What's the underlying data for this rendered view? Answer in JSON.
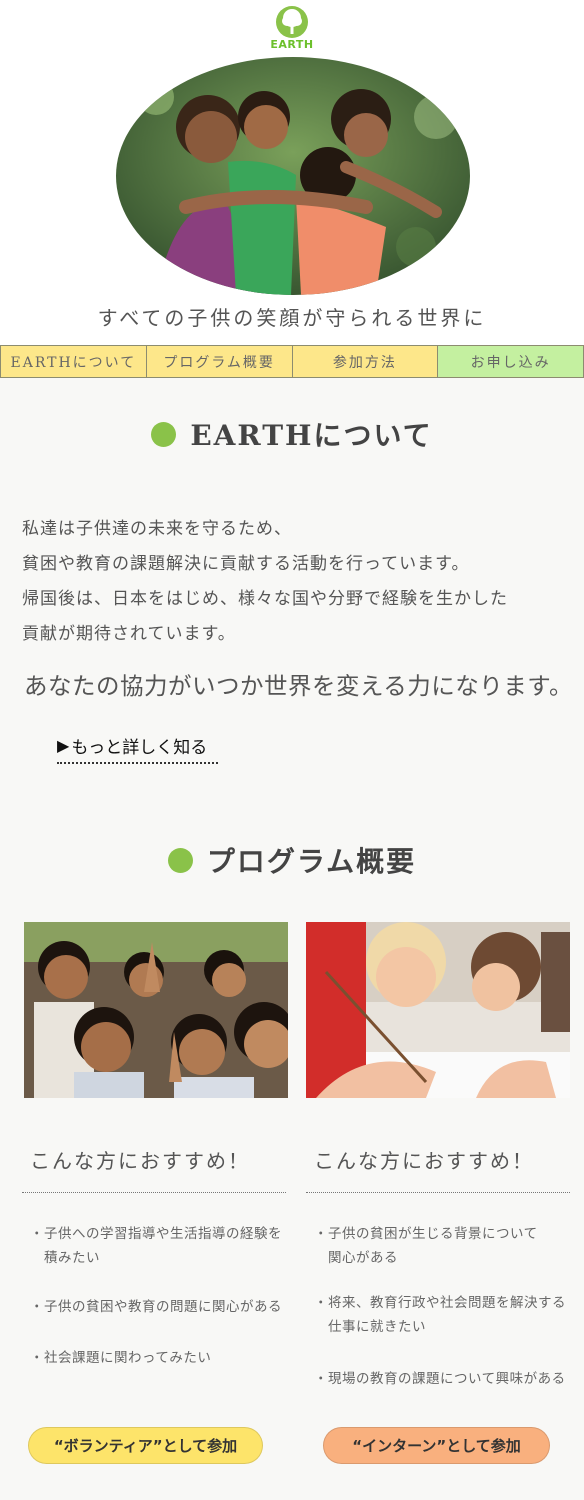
{
  "brand": {
    "logo_text": "EARTH",
    "logo_color": "#6cc02c"
  },
  "hero": {
    "tagline": "すべての子供の笑顔が守られる世界に"
  },
  "nav": {
    "items": [
      {
        "label": "EARTHについて"
      },
      {
        "label": "プログラム概要"
      },
      {
        "label": "参加方法"
      },
      {
        "label": "お申し込み"
      }
    ],
    "colors": {
      "default": "#fde78a",
      "active": "#c4f0a0"
    }
  },
  "about": {
    "title": "EARTHについて",
    "lines": [
      "私達は子供達の未来を守るため、",
      "貧困や教育の課題解決に貢献する活動を行っています。",
      "帰国後は、日本をはじめ、様々な国や分野で経験を生かした",
      "貢献が期待されています。"
    ],
    "message": "あなたの協力がいつか世界を変える力になります。",
    "more_link": "もっと詳しく知る"
  },
  "program": {
    "title": "プログラム概要",
    "cards": [
      {
        "rec_title": "こんな方におすすめ！",
        "items": [
          "子供への学習指導や生活指導の経験を\n積みたい",
          "子供の貧困や教育の問題に関心がある",
          "社会課題に関わってみたい"
        ],
        "cta": "“ボランティア”として参加",
        "cta_color": "#fde46a"
      },
      {
        "rec_title": "こんな方におすすめ！",
        "items": [
          "子供の貧困が生じる背景について\n関心がある",
          "将来、教育行政や社会問題を解決する\n仕事に就きたい",
          "現場の教育の課題について興味がある"
        ],
        "cta": "“インターン”として参加",
        "cta_color": "#f9b07e"
      }
    ]
  },
  "accent_color": "#8ac249"
}
